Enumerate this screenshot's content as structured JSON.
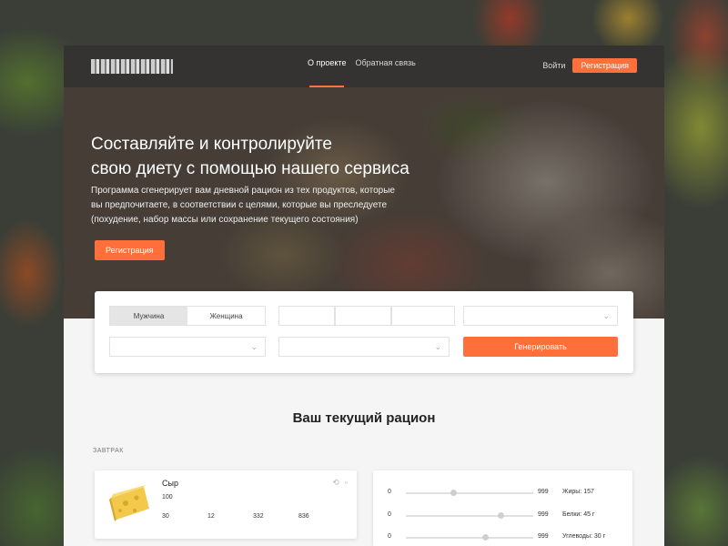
{
  "nav": {
    "logo_text": "",
    "links": [
      "О проекте",
      "Обратная связь"
    ],
    "login": "Войти",
    "register": "Регистрация"
  },
  "hero": {
    "title_line1": "Составляйте и контролируйте",
    "title_line2": "свою диету с помощью нашего сервиса",
    "text_line1": "Программа сгенерирует вам дневной рацион из тех продуктов, которые",
    "text_line2": "вы предпочитаете, в соответствии с целями, которые вы преследуете",
    "text_line3": "(похудение, набор массы или сохранение текущего состояния)",
    "button": "Регистрация"
  },
  "form": {
    "gender": [
      "Мужчина",
      "Женщина"
    ],
    "age_placeholder": "",
    "height_placeholder": "",
    "weight_placeholder": "",
    "goal_placeholder": "",
    "activity_placeholder": "",
    "products_placeholder": "",
    "generate": "Генерировать"
  },
  "ration": {
    "title": "Ваш текущий рацион",
    "meal": "ЗАВТРАК",
    "food": {
      "name": "Сыр",
      "qty_label": "",
      "qty_value": "100",
      "nutrient_headers": [
        "",
        "",
        "",
        ""
      ],
      "nutrient_values": [
        "30",
        "12",
        "332",
        "836"
      ]
    },
    "sliders": [
      {
        "min": "0",
        "max": "999",
        "label": "Жиры: 157",
        "level": 0.35
      },
      {
        "min": "0",
        "max": "999",
        "label": "Белки: 45 г",
        "level": 0.72
      },
      {
        "min": "0",
        "max": "999",
        "label": "Углеводы: 30 г",
        "level": 0.6
      }
    ]
  },
  "colors": {
    "accent": "#ff6f3c",
    "text_dark": "#222222"
  }
}
